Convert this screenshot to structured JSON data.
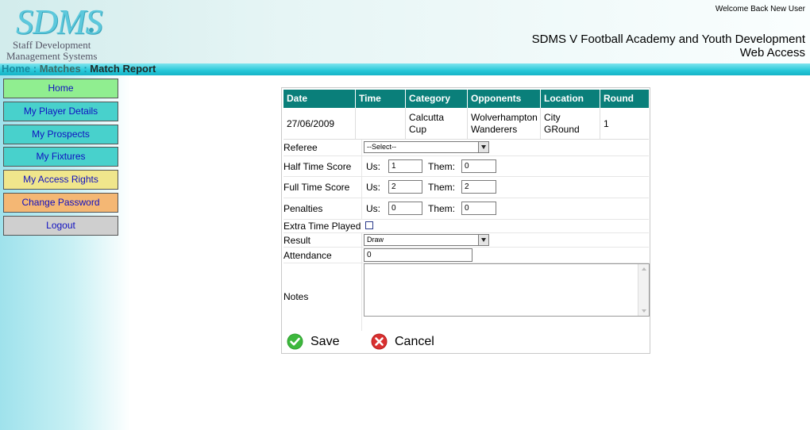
{
  "logo": {
    "mark": "SDMS",
    "line1": "Staff Development",
    "line2": "Management Systems"
  },
  "header": {
    "welcome": "Welcome Back New User",
    "title_line1": "SDMS V Football Academy and Youth Development",
    "title_line2": "Web Access"
  },
  "breadcrumb": {
    "home": "Home",
    "sep1": " : ",
    "matches": "Matches",
    "sep2": " : ",
    "current": "Match Report"
  },
  "sidebar": {
    "items": [
      {
        "label": "Home",
        "color": "#90ee90"
      },
      {
        "label": "My Player Details",
        "color": "#48d1cc"
      },
      {
        "label": "My Prospects",
        "color": "#48d1cc"
      },
      {
        "label": "My Fixtures",
        "color": "#48d1cc"
      },
      {
        "label": "My Access Rights",
        "color": "#f0e68c"
      },
      {
        "label": "Change Password",
        "color": "#f4b774"
      },
      {
        "label": "Logout",
        "color": "#cfcfcf"
      }
    ]
  },
  "fixture": {
    "headers": [
      "Date",
      "Time",
      "Category",
      "Opponents",
      "Location",
      "Round"
    ],
    "row": {
      "date": "27/06/2009",
      "time": "",
      "category_l1": "Calcutta",
      "category_l2": "Cup",
      "opponents_l1": "Wolverhampton",
      "opponents_l2": "Wanderers",
      "location_l1": "City",
      "location_l2": "GRound",
      "round": "1"
    }
  },
  "form": {
    "referee_label": "Referee",
    "referee_value": "--Select--",
    "half_label": "Half Time Score",
    "full_label": "Full Time Score",
    "pen_label": "Penalties",
    "us_label": "Us:",
    "them_label": "Them:",
    "half_us": "1",
    "half_them": "0",
    "full_us": "2",
    "full_them": "2",
    "pen_us": "0",
    "pen_them": "0",
    "extra_label": "Extra Time Played",
    "result_label": "Result",
    "result_value": "Draw",
    "attendance_label": "Attendance",
    "attendance_value": "0",
    "notes_label": "Notes",
    "save_label": "Save",
    "cancel_label": "Cancel"
  },
  "colors": {
    "header_teal": "#0a7f7a",
    "save_green": "#2ea02e",
    "cancel_red": "#d02525"
  }
}
